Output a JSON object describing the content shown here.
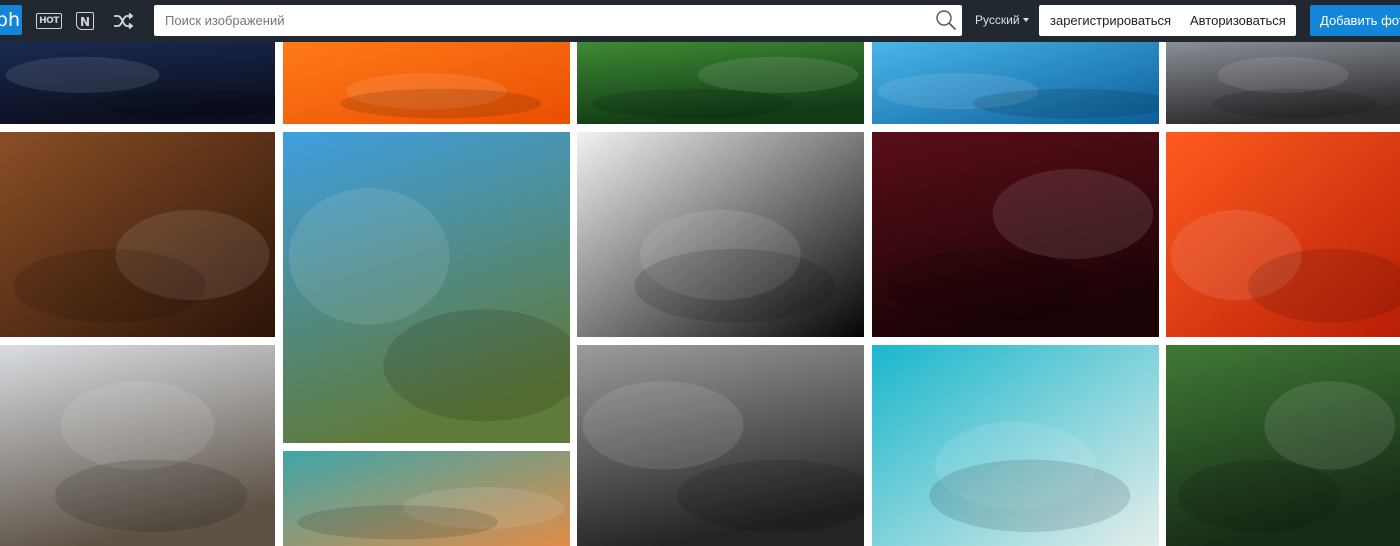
{
  "header": {
    "logo_text": "ph",
    "hot_icon_text": "HOT",
    "new_icon_text": "N",
    "search": {
      "value": "",
      "placeholder": "Поиск изображений"
    },
    "language": "Русский",
    "register_label": "зарегистрироваться",
    "login_label": "Авторизоваться",
    "add_photo_label": "Добавить фото"
  },
  "gallery": {
    "tiles": [
      {
        "name": "photo-city-night-skyline",
        "colors": [
          "#1a2a52",
          "#0b0f1e"
        ]
      },
      {
        "name": "photo-orange-fabric",
        "colors": [
          "#ff7a1a",
          "#e94f00"
        ]
      },
      {
        "name": "photo-green-lotus-leaves",
        "colors": [
          "#3e8a33",
          "#113a17"
        ]
      },
      {
        "name": "photo-blue-water",
        "colors": [
          "#49b6ea",
          "#0b5d99"
        ]
      },
      {
        "name": "photo-person-lights",
        "colors": [
          "#8a8f96",
          "#2c2b2e"
        ]
      },
      {
        "name": "photo-kids-firewood",
        "colors": [
          "#8a4e26",
          "#2b1408"
        ]
      },
      {
        "name": "photo-coast-beach",
        "colors": [
          "#3f9fe0",
          "#5f7a3a"
        ]
      },
      {
        "name": "photo-silhouettes-window",
        "colors": [
          "#f2f2f2",
          "#050505"
        ]
      },
      {
        "name": "photo-light-bulbs",
        "colors": [
          "#5a0e18",
          "#1b0306"
        ]
      },
      {
        "name": "photo-tomato-sauce",
        "colors": [
          "#ff5b1f",
          "#b81e06"
        ]
      },
      {
        "name": "photo-new-york-skyline",
        "colors": [
          "#d9dde2",
          "#5d5246"
        ]
      },
      {
        "name": "photo-art-studio",
        "colors": [
          "#3fa6a8",
          "#e08c47"
        ]
      },
      {
        "name": "photo-old-man-hat",
        "colors": [
          "#9c9c9c",
          "#242424"
        ]
      },
      {
        "name": "photo-aerial-beach",
        "colors": [
          "#19b7cc",
          "#e4edea"
        ]
      },
      {
        "name": "photo-forest-road",
        "colors": [
          "#3f7a35",
          "#162a16"
        ]
      }
    ]
  }
}
